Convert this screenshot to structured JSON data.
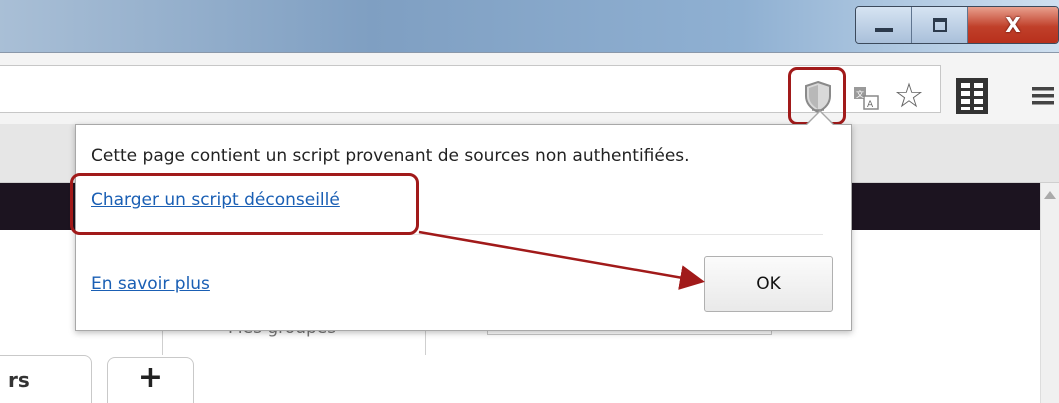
{
  "window": {
    "minimize_icon": "minimize-icon",
    "maximize_icon": "restore-icon",
    "close_label": "X"
  },
  "toolbar": {
    "icons": [
      "shield-icon",
      "translate-icon",
      "star-icon",
      "extension-icon",
      "menu-icon"
    ]
  },
  "popup": {
    "message": "Cette page contient un script provenant de sources non authentifiées.",
    "load_script_link": "Charger un script déconseillé",
    "learn_more_link": "En savoir plus",
    "ok_button": "OK"
  },
  "page": {
    "groups_label": "Mes groupes",
    "tab_partial_label": "rs",
    "new_tab_label": "+"
  },
  "colors": {
    "annotation": "#a11a1a",
    "link": "#1a5fb4",
    "dark_bar": "#1c1420"
  }
}
